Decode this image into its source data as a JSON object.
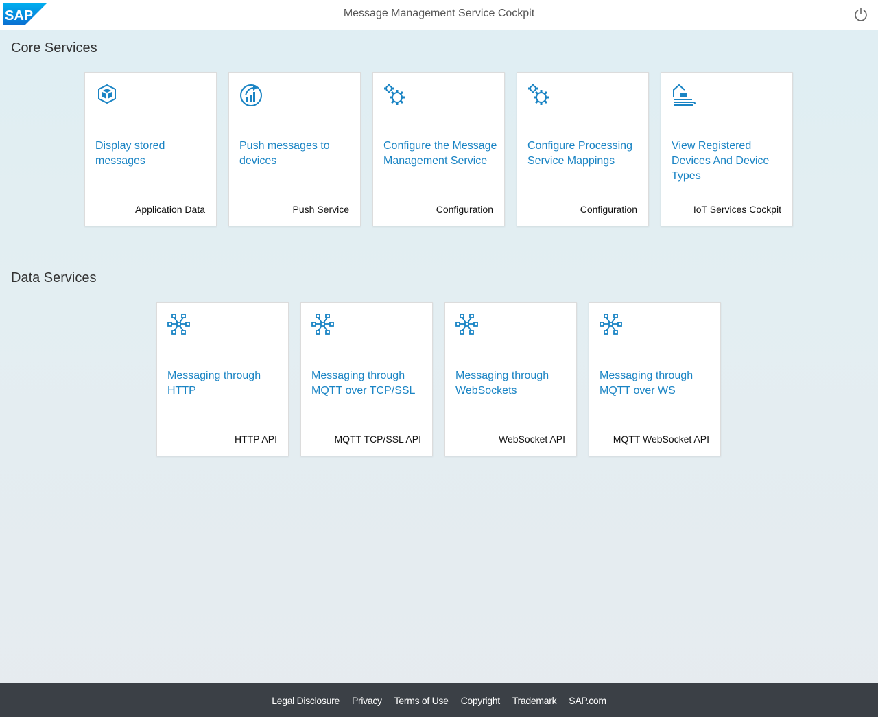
{
  "shell": {
    "title": "Message Management Service Cockpit",
    "logo_text": "SAP",
    "power_icon": "power-icon"
  },
  "sections": [
    {
      "title": "Core Services",
      "tiles": [
        {
          "icon": "cube-icon",
          "title": "Display stored messages",
          "footer": "Application Data"
        },
        {
          "icon": "push-chart-icon",
          "title": "Push messages to devices",
          "footer": "Push Service"
        },
        {
          "icon": "gears-icon",
          "title": "Configure the Message Management Service",
          "footer": "Configuration"
        },
        {
          "icon": "gears-icon",
          "title": "Configure Processing Service Mappings",
          "footer": "Configuration"
        },
        {
          "icon": "home-devices-icon",
          "title": "View Registered Devices And Device Types",
          "footer": "IoT Services Cockpit"
        }
      ]
    },
    {
      "title": "Data Services",
      "tiles": [
        {
          "icon": "network-icon",
          "title": "Messaging through HTTP",
          "footer": "HTTP API"
        },
        {
          "icon": "network-icon",
          "title": "Messaging through MQTT over TCP/SSL",
          "footer": "MQTT TCP/SSL API"
        },
        {
          "icon": "network-icon",
          "title": "Messaging through WebSockets",
          "footer": "WebSocket API"
        },
        {
          "icon": "network-icon",
          "title": "Messaging through MQTT over WS",
          "footer": "MQTT WebSocket API"
        }
      ]
    }
  ],
  "footer": {
    "links": [
      "Legal Disclosure",
      "Privacy",
      "Terms of Use",
      "Copyright",
      "Trademark",
      "SAP.com"
    ]
  },
  "colors": {
    "accent": "#1a84c4",
    "footer_bg": "#3b4046"
  }
}
